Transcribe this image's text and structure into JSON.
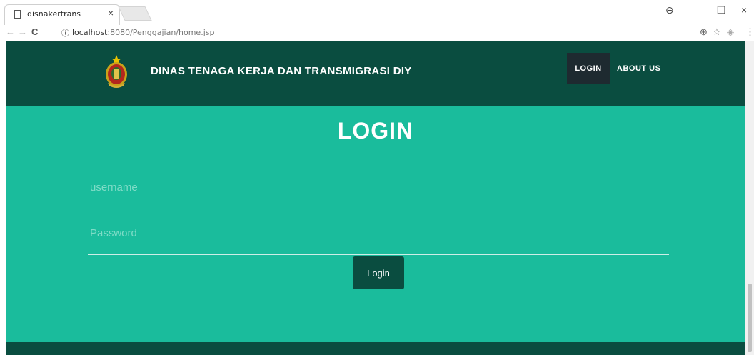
{
  "browser": {
    "tab_title": "disnakertrans",
    "tab_close": "×",
    "url_host": "localhost",
    "url_rest": ":8080/Penggajian/home.jsp",
    "window_controls": {
      "account": "⊖",
      "minimize": "–",
      "restore": "❐",
      "close": "×"
    },
    "nav": {
      "back": "←",
      "forward": "→",
      "reload": "C"
    },
    "info_icon": "ⓘ",
    "right_icons": {
      "zoom": "⊕",
      "star": "☆",
      "extension": "◈",
      "menu": "⋮"
    }
  },
  "navbar": {
    "brand": "DINAS TENAGA KERJA DAN TRANSMIGRASI DIY",
    "links": [
      {
        "label": "LOGIN",
        "active": true
      },
      {
        "label": "ABOUT US",
        "active": false
      }
    ]
  },
  "login": {
    "title": "LOGIN",
    "username_placeholder": "username",
    "password_placeholder": "Password",
    "button_label": "Login"
  },
  "colors": {
    "navbar": "#0a4d40",
    "page_background": "#1abc9c",
    "active_nav": "#1e2a30",
    "button": "#0a4d40"
  }
}
